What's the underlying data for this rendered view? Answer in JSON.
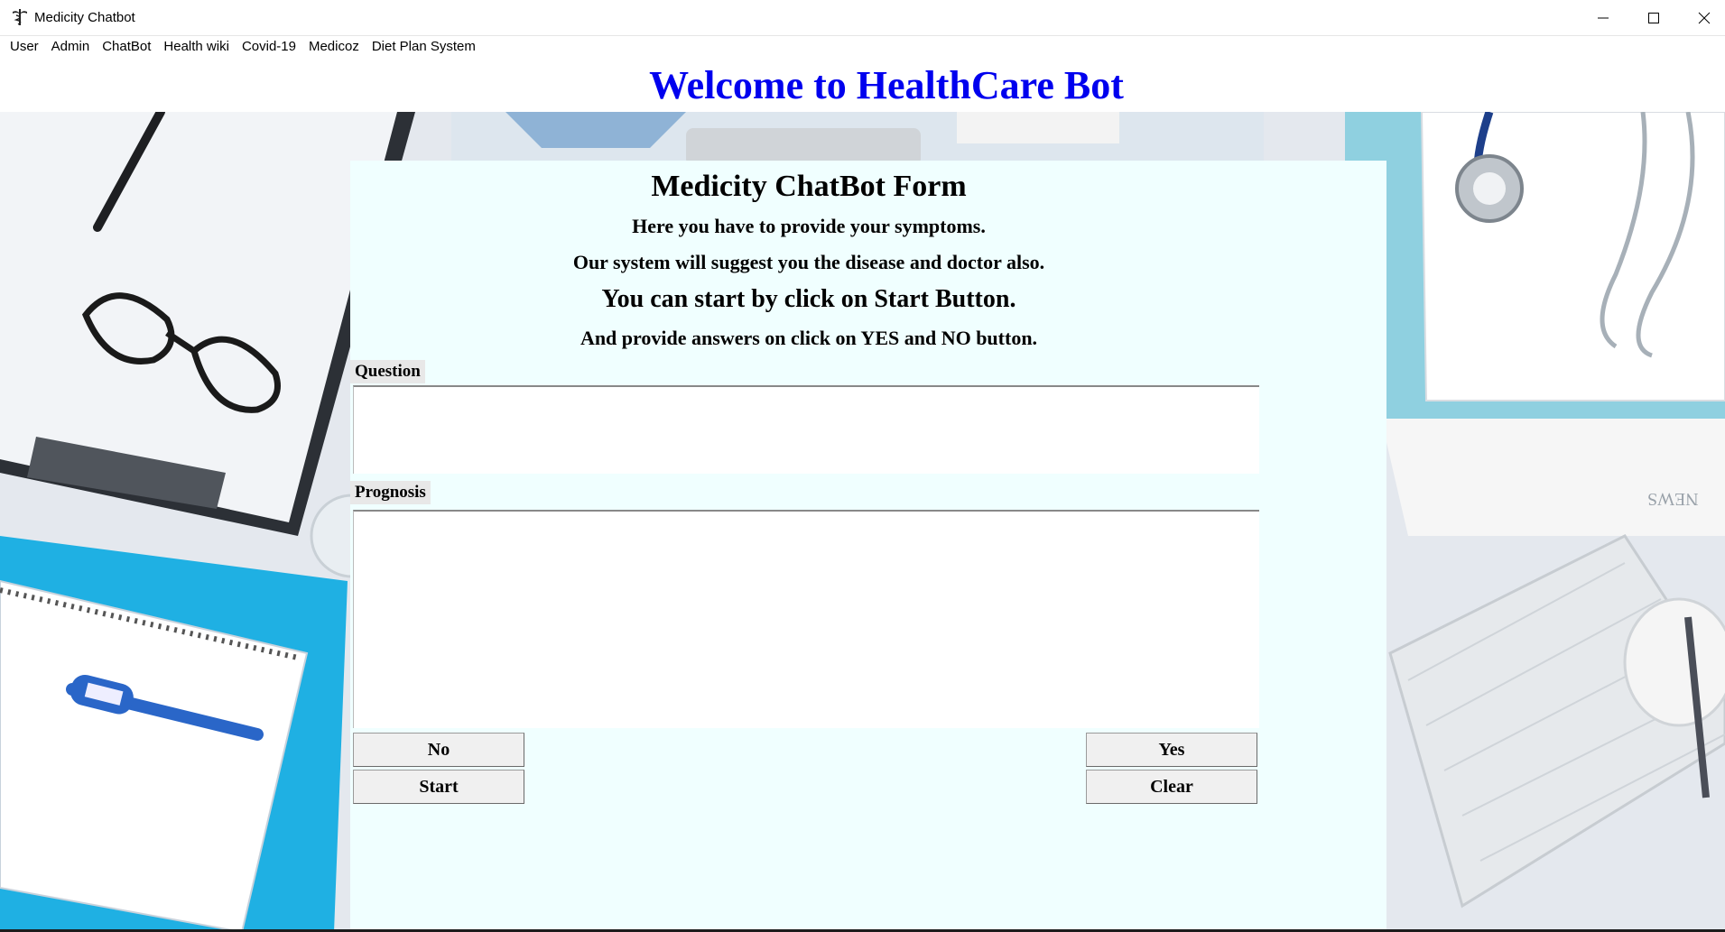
{
  "window": {
    "title": "Medicity Chatbot"
  },
  "menu": [
    "User",
    "Admin",
    "ChatBot",
    "Health wiki",
    "Covid-19",
    "Medicoz",
    "Diet Plan System"
  ],
  "header": {
    "title": "Welcome to HealthCare Bot"
  },
  "form": {
    "title": "Medicity ChatBot Form",
    "line1": "Here you have to provide your symptoms.",
    "line2": "Our system will suggest you  the disease and doctor also.",
    "line3": "You can start by click on Start Button.",
    "line4": "And provide answers on click on YES and NO button.",
    "question_label": "Question",
    "prognosis_label": "Prognosis",
    "question_value": "",
    "prognosis_value": "",
    "buttons": {
      "no": "No",
      "start": "Start",
      "yes": "Yes",
      "clear": "Clear"
    }
  },
  "background_note_text": "NEWS",
  "colors": {
    "header_title": "#0000ee",
    "form_bg": "#f0ffff",
    "accent_blue": "#29b3e8"
  },
  "icons": {
    "app": "caduceus-icon",
    "minimize": "minimize-icon",
    "maximize": "maximize-icon",
    "close": "close-icon"
  }
}
